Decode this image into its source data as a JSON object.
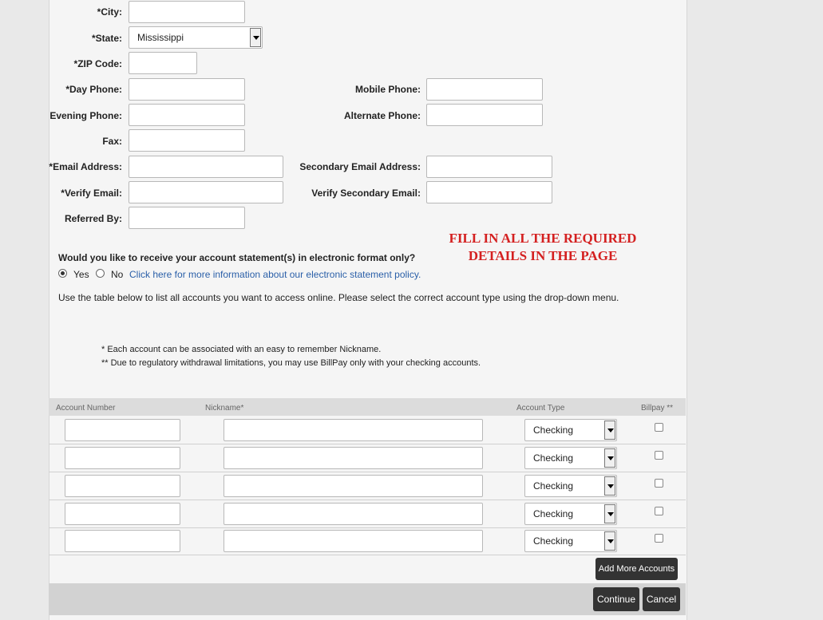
{
  "form": {
    "city_label": "*City:",
    "state_label": "*State:",
    "state_value": "Mississippi",
    "zip_label": "*ZIP Code:",
    "day_phone_label": "*Day Phone:",
    "mobile_phone_label": "Mobile Phone:",
    "evening_phone_label": "Evening Phone:",
    "alternate_phone_label": "Alternate Phone:",
    "fax_label": "Fax:",
    "email_label": "*Email Address:",
    "secondary_email_label": "Secondary Email Address:",
    "verify_email_label": "*Verify Email:",
    "verify_secondary_email_label": "Verify Secondary Email:",
    "referred_by_label": "Referred By:"
  },
  "notice": {
    "line1": "FILL IN ALL THE REQUIRED",
    "line2": "DETAILS IN THE PAGE"
  },
  "estatement": {
    "question": "Would you like to receive your account statement(s) in electronic format only?",
    "yes_label": "Yes",
    "no_label": "No",
    "selected": "Yes",
    "policy_link": "Click here for more information about our electronic statement policy."
  },
  "instructions": "Use the table below to list all accounts you want to access online. Please select the correct account type using the drop-down menu.",
  "footnotes": {
    "note1": "* Each account can be associated with an easy to remember Nickname.",
    "note2": "** Due to regulatory withdrawal limitations, you may use BillPay only with your checking accounts."
  },
  "table": {
    "headers": {
      "account_number": "Account Number",
      "nickname": "Nickname*",
      "account_type": "Account Type",
      "billpay": "Billpay **"
    },
    "rows": [
      {
        "account_number": "",
        "nickname": "",
        "account_type": "Checking",
        "billpay": false
      },
      {
        "account_number": "",
        "nickname": "",
        "account_type": "Checking",
        "billpay": false
      },
      {
        "account_number": "",
        "nickname": "",
        "account_type": "Checking",
        "billpay": false
      },
      {
        "account_number": "",
        "nickname": "",
        "account_type": "Checking",
        "billpay": false
      },
      {
        "account_number": "",
        "nickname": "",
        "account_type": "Checking",
        "billpay": false
      }
    ]
  },
  "buttons": {
    "add_more_accounts": "Add More Accounts",
    "continue": "Continue",
    "cancel": "Cancel"
  },
  "colors": {
    "notice_text": "#d42020",
    "link": "#2a5fa8",
    "button_bg": "#333333"
  }
}
